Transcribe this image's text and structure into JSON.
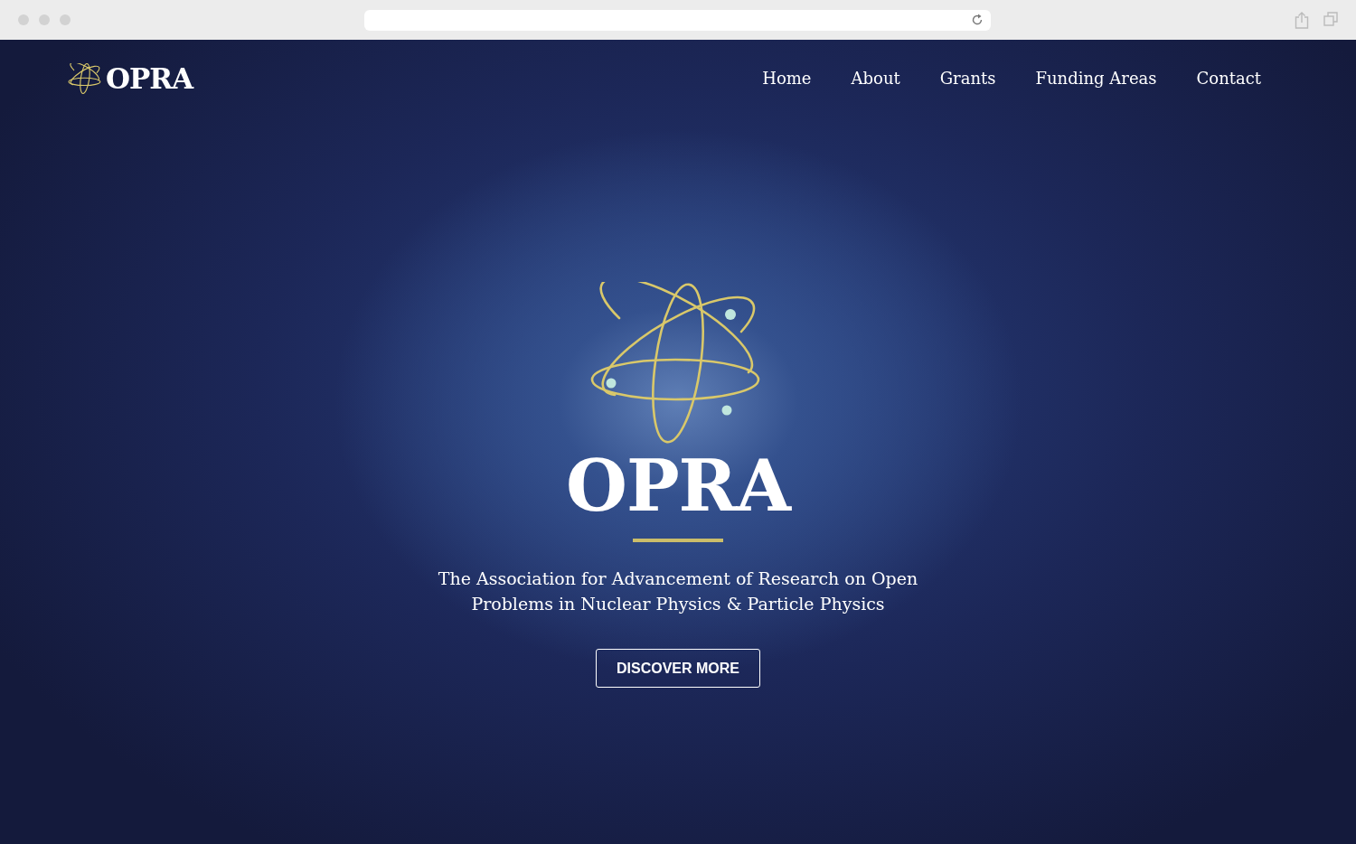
{
  "logo": {
    "text": "OPRA"
  },
  "nav": [
    {
      "label": "Home"
    },
    {
      "label": "About"
    },
    {
      "label": "Grants"
    },
    {
      "label": "Funding Areas"
    },
    {
      "label": "Contact"
    }
  ],
  "hero": {
    "title": "OPRA",
    "subtitle": "The Association for Advancement of Research on Open Problems in Nuclear Physics & Particle Physics",
    "button": "DISCOVER MORE"
  }
}
